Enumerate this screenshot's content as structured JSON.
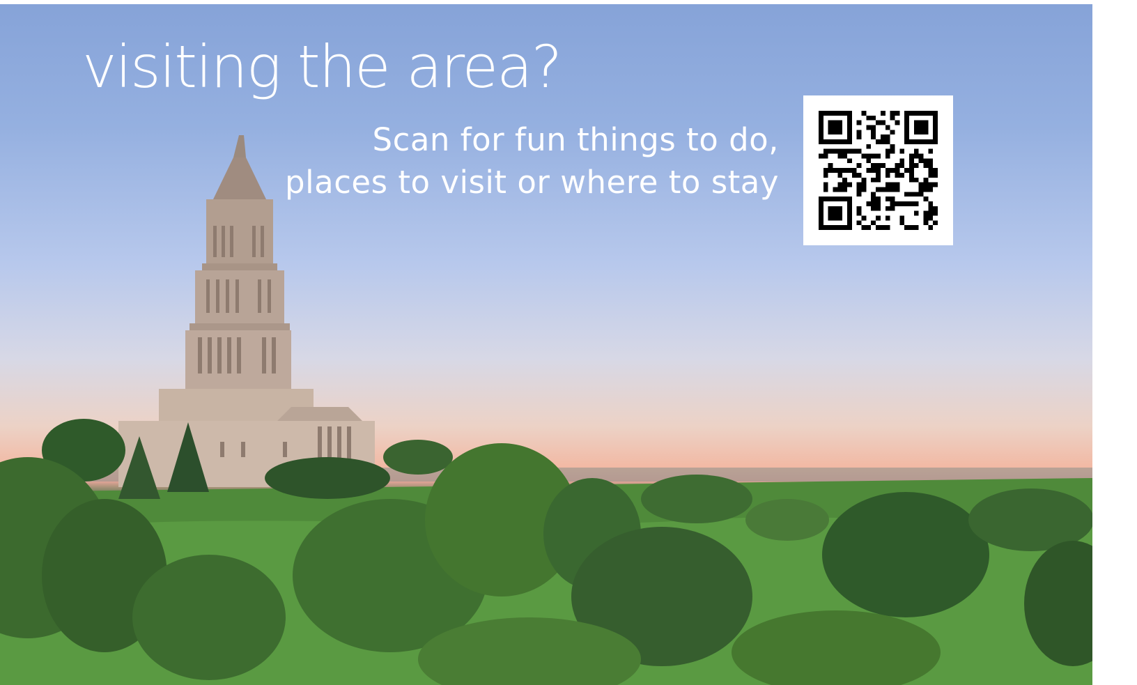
{
  "banner": {
    "headline": "visiting the area?",
    "subtext_line1": "Scan for fun things to do,",
    "subtext_line2": "places to visit or where to stay"
  },
  "qr_code": {
    "icon": "qr-code-icon"
  },
  "colors": {
    "text": "#ffffff",
    "sky_top": "#86a3d8",
    "sky_horizon": "#f2b9a4",
    "foliage": "#3f6a34",
    "monument": "#c8b4a4"
  }
}
